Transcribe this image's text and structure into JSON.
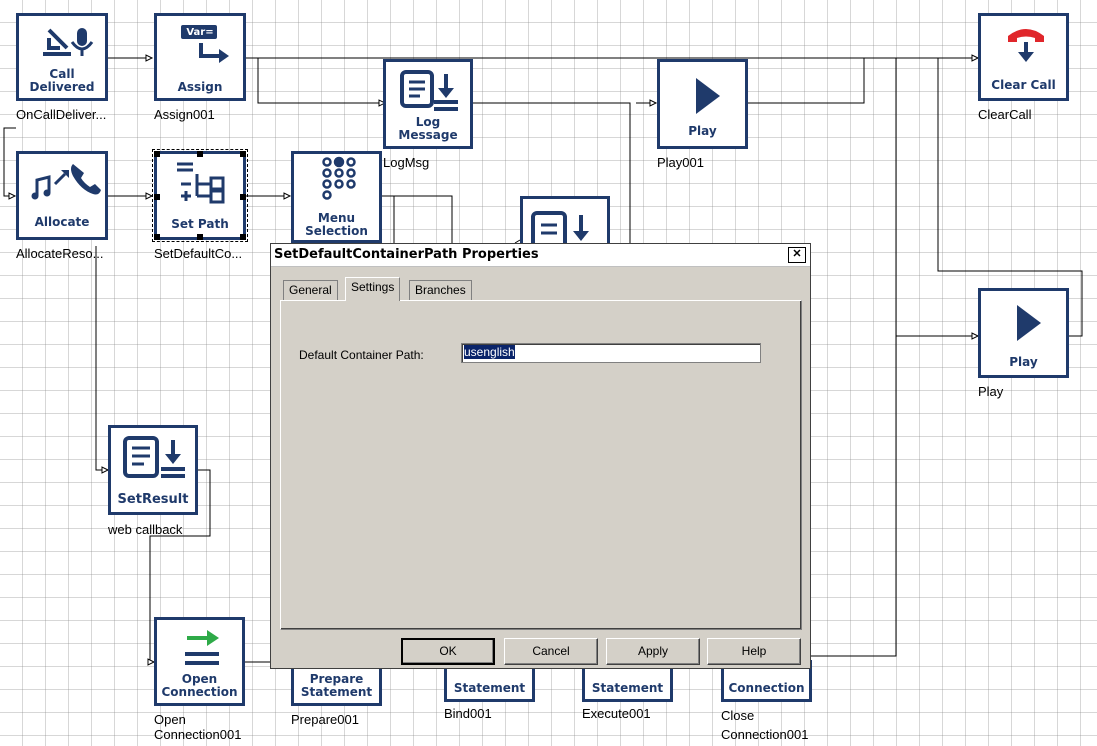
{
  "nodes": {
    "call_delivered": {
      "label": "Call\nDelivered",
      "caption": "OnCallDeliver..."
    },
    "assign": {
      "label": "Assign",
      "caption": "Assign001",
      "icon_text": "Var="
    },
    "log_message": {
      "label": "Log\nMessage",
      "caption": "LogMsg"
    },
    "play1": {
      "label": "Play",
      "caption": "Play001"
    },
    "clear_call": {
      "label": "Clear Call",
      "caption": "ClearCall"
    },
    "allocate": {
      "label": "Allocate",
      "caption": "AllocateReso..."
    },
    "set_path": {
      "label": "Set Path",
      "caption": "SetDefaultCo..."
    },
    "menu_selection": {
      "label": "Menu\nSelection",
      "caption": ""
    },
    "play2": {
      "label": "Play",
      "caption": "Play"
    },
    "set_result": {
      "label": "SetResult",
      "caption": "web callback"
    },
    "open_connection": {
      "label": "Open\nConnection",
      "caption": "Open\nConnection001"
    },
    "prepare_statement": {
      "label": "Prepare\nStatement",
      "caption": "Prepare001"
    },
    "bind_statement": {
      "label": "Statement",
      "caption": "Bind001"
    },
    "execute_statement": {
      "label": "Statement",
      "caption": "Execute001"
    },
    "close_connection": {
      "label": "Connection",
      "caption": "Close\nConnection001"
    }
  },
  "dialog": {
    "title": "SetDefaultContainerPath Properties",
    "close_glyph": "✕",
    "tabs": [
      "General",
      "Settings",
      "Branches"
    ],
    "active_tab": "Settings",
    "field_label": "Default Container Path:",
    "field_value": "usenglish",
    "buttons": {
      "ok": "OK",
      "cancel": "Cancel",
      "apply": "Apply",
      "help": "Help"
    }
  },
  "colors": {
    "node_border": "#1f3a6b",
    "clear_call_icon": "#e0262b",
    "open_connection_arrow": "#2eaa48",
    "selection": "#0a246a"
  }
}
